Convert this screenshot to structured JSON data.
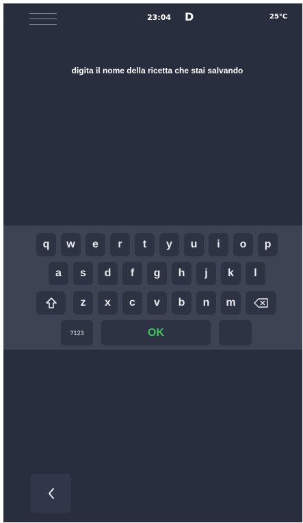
{
  "status_bar": {
    "time": "23:04",
    "mode": "D",
    "temperature": "25°C"
  },
  "prompt": "digita il nome della ricetta che stai salvando",
  "keyboard": {
    "row1": [
      "q",
      "w",
      "e",
      "r",
      "t",
      "y",
      "u",
      "i",
      "o",
      "p"
    ],
    "row2": [
      "a",
      "s",
      "d",
      "f",
      "g",
      "h",
      "j",
      "k",
      "l"
    ],
    "row3": [
      "z",
      "x",
      "c",
      "v",
      "b",
      "n",
      "m"
    ],
    "numbers_label": "?123",
    "ok_label": "OK"
  },
  "icons": {
    "menu": "hamburger-icon",
    "shift": "shift-arrow-icon",
    "backspace": "backspace-icon",
    "back": "chevron-left-icon"
  },
  "colors": {
    "background": "#282e3d",
    "keyboard_background": "#3d4352",
    "key": "#2e3343",
    "ok_text": "#3ec45a"
  }
}
